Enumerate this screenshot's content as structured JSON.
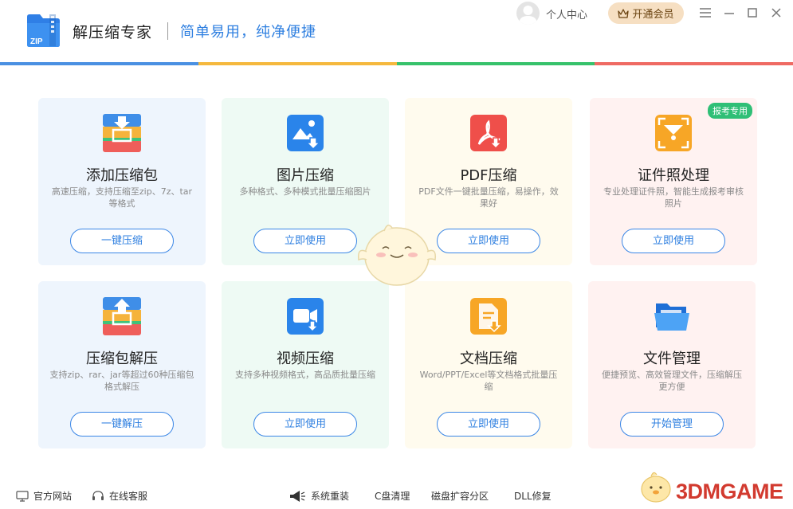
{
  "header": {
    "logo_text": "ZIP",
    "app_name": "解压缩专家",
    "slogan": "简单易用，纯净便捷",
    "user_center": "个人中心",
    "vip_button": "开通会员"
  },
  "accent_colors": [
    "#4a90e2",
    "#f5b83d",
    "#36c26b",
    "#ef6a63"
  ],
  "cards": [
    {
      "title": "添加压缩包",
      "desc": "高速压缩，支持压缩至zip、7z、tar等格式",
      "action": "一键压缩",
      "bg": "#eef5fd",
      "icon": "add-archive-icon"
    },
    {
      "title": "图片压缩",
      "desc": "多种格式、多种模式批量压缩图片",
      "action": "立即使用",
      "bg": "#eefaf4",
      "icon": "image-compress-icon"
    },
    {
      "title": "PDF压缩",
      "desc": "PDF文件一键批量压缩，易操作，效果好",
      "action": "立即使用",
      "bg": "#fffbee",
      "icon": "pdf-compress-icon"
    },
    {
      "title": "证件照处理",
      "desc": "专业处理证件照，智能生成报考审核照片",
      "action": "立即使用",
      "bg": "#fff2f1",
      "icon": "id-photo-icon",
      "badge": "报考专用"
    },
    {
      "title": "压缩包解压",
      "desc": "支持zip、rar、jar等超过60种压缩包格式解压",
      "action": "一键解压",
      "bg": "#eef5fd",
      "icon": "extract-archive-icon"
    },
    {
      "title": "视频压缩",
      "desc": "支持多种视频格式，高品质批量压缩",
      "action": "立即使用",
      "bg": "#eefaf4",
      "icon": "video-compress-icon"
    },
    {
      "title": "文档压缩",
      "desc": "Word/PPT/Excel等文档格式批量压缩",
      "action": "立即使用",
      "bg": "#fffbee",
      "icon": "document-compress-icon"
    },
    {
      "title": "文件管理",
      "desc": "便捷预览、高效管理文件，压缩解压更方便",
      "action": "开始管理",
      "bg": "#fff2f1",
      "icon": "file-manager-icon"
    }
  ],
  "footer": {
    "official_site": "官方网站",
    "online_service": "在线客服",
    "system_reinstall": "系统重装",
    "c_drive_clean": "C盘清理",
    "disk_partition": "磁盘扩容分区",
    "dll_repair": "DLL修复"
  },
  "watermark": "3DMGAME"
}
